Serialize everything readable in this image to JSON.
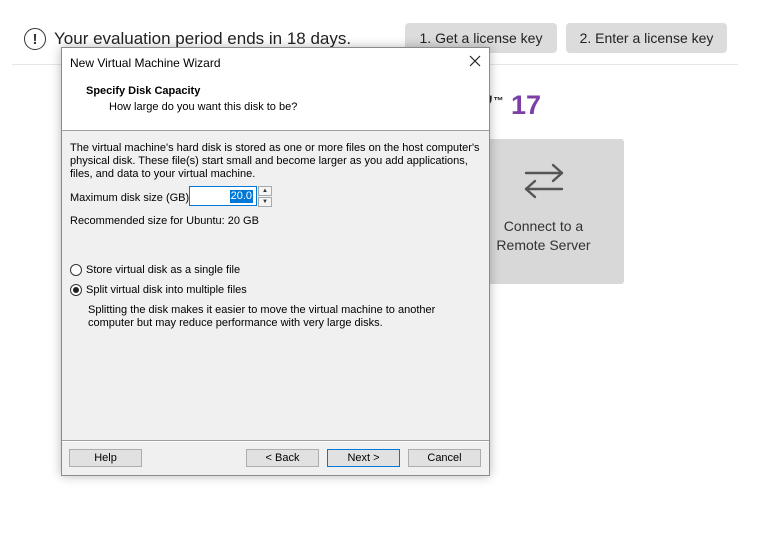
{
  "app": {
    "eval_banner_text": "Your evaluation period ends in 18 days.",
    "eval_icon_glyph": "!",
    "license_buttons": [
      "1. Get a license key",
      "2. Enter a license key"
    ],
    "brand_suffix": "17",
    "brand_color": "#7b3fa6",
    "tile": {
      "line1": "Connect to a",
      "line2": "Remote Server",
      "icon": "transfer-arrows-icon"
    }
  },
  "dialog": {
    "title": "New Virtual Machine Wizard",
    "header_title": "Specify Disk Capacity",
    "header_subtitle": "How large do you want this disk to be?",
    "description": "The virtual machine's hard disk is stored as one or more files on the host computer's physical disk. These file(s) start small and become larger as you add applications, files, and data to your virtual machine.",
    "size_label": "Maximum disk size (GB):",
    "size_value": "20.0",
    "recommended": "Recommended size for Ubuntu: 20 GB",
    "option_single": "Store virtual disk as a single file",
    "option_split": "Split virtual disk into multiple files",
    "selected_option": "split",
    "split_note": "Splitting the disk makes it easier to move the virtual machine to another computer but may reduce performance with very large disks.",
    "buttons": {
      "help": "Help",
      "back": "< Back",
      "next": "Next >",
      "cancel": "Cancel"
    }
  }
}
